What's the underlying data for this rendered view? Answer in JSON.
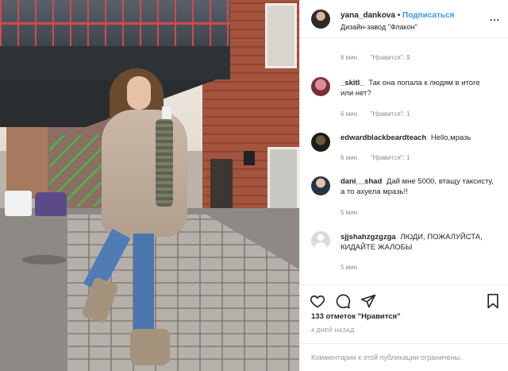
{
  "post": {
    "username": "yana_dankova",
    "separator": "•",
    "follow_label": "Подписаться",
    "location": "Дизайн-завод \"Флакон\"",
    "more_label": "..."
  },
  "caption_meta": {
    "time": "6 мин.",
    "likes": "\"Нравится\": 9"
  },
  "comments": [
    {
      "username": "_skitl_",
      "text": "Так она попала к людям в итоге или нет?",
      "time": "6 мин.",
      "likes": "\"Нравится\": 1"
    },
    {
      "username": "edwardblackbeardteach",
      "text": "Hello,мразь",
      "time": "6 мин.",
      "likes": "\"Нравится\": 1"
    },
    {
      "username": "dani__shad",
      "text": "Дай мне 5000, втащу таксисту, а то ахуела мразь!!",
      "time": "5 мин."
    },
    {
      "username": "sjjshahzgzgzga",
      "text": "ЛЮДИ, ПОЖАЛУЙСТА, КИДАЙТЕ ЖАЛОБЫ",
      "time": "5 мин."
    }
  ],
  "actions": {
    "like_icon": "heart-icon",
    "comment_icon": "comment-icon",
    "share_icon": "share-icon",
    "save_icon": "bookmark-icon"
  },
  "likes_count": "133 отметок \"Нравится\"",
  "post_date": "4 ДНЕЙ НАЗАД",
  "comments_disabled": "Комментарии к этой публикации ограничены.",
  "colors": {
    "accent": "#3897f0",
    "muted": "#8e8e8e",
    "text": "#262626"
  }
}
